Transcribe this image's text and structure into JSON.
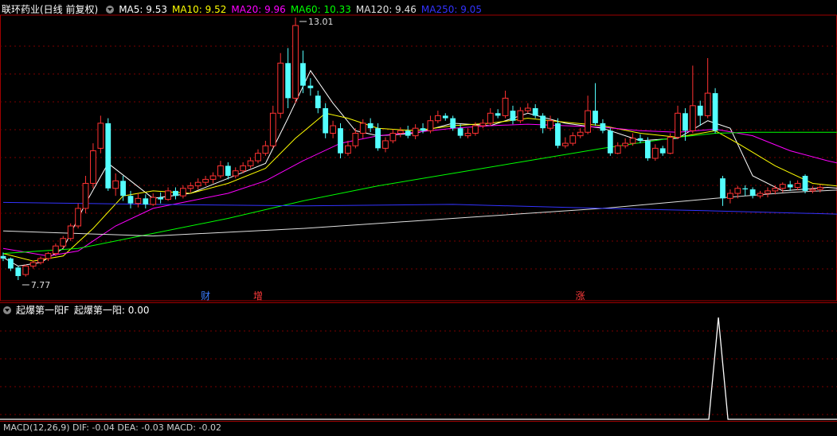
{
  "stock_title": "联环药业(日线 前复权)",
  "ma_legend": [
    {
      "label": "MA5: 9.53",
      "color": "#ffffff"
    },
    {
      "label": "MA10: 9.52",
      "color": "#ffff00"
    },
    {
      "label": "MA20: 9.96",
      "color": "#ff00ff"
    },
    {
      "label": "MA60: 10.33",
      "color": "#00ff00"
    },
    {
      "label": "MA120: 9.46",
      "color": "#e0e0e0"
    },
    {
      "label": "MA250: 9.05",
      "color": "#3333ff"
    }
  ],
  "high_label": "13.01",
  "low_label": "7.77",
  "event_markers": [
    "财",
    "增",
    "涨"
  ],
  "indicator_title": "起爆第一阳F",
  "indicator_value_label": "起爆第一阳: 0.00",
  "bottom_legend": "MACD(12,26,9)  DIF: -0.04  DEA: -0.03  MACD: -0.02",
  "colors": {
    "up": "#ff3232",
    "down": "#54ffff",
    "grid": "#7a0000",
    "border": "#a00000"
  },
  "chart_data": {
    "type": "candlestick",
    "y_high": 13.01,
    "y_low": 7.77,
    "candles": [
      [
        8.25,
        8.2,
        8.32,
        8.15
      ],
      [
        8.2,
        8.0,
        8.22,
        7.95
      ],
      [
        8.02,
        7.85,
        8.05,
        7.77
      ],
      [
        7.88,
        8.05,
        8.08,
        7.84
      ],
      [
        8.05,
        8.12,
        8.16,
        8.0
      ],
      [
        8.12,
        8.2,
        8.24,
        8.08
      ],
      [
        8.2,
        8.3,
        8.33,
        8.15
      ],
      [
        8.3,
        8.45,
        8.5,
        8.25
      ],
      [
        8.45,
        8.6,
        8.65,
        8.4
      ],
      [
        8.6,
        8.85,
        8.9,
        8.55
      ],
      [
        8.85,
        9.2,
        9.3,
        8.8
      ],
      [
        9.2,
        9.7,
        9.85,
        9.1
      ],
      [
        9.7,
        10.35,
        10.5,
        9.6
      ],
      [
        10.4,
        10.9,
        11.05,
        10.3
      ],
      [
        10.9,
        9.6,
        11.0,
        9.55
      ],
      [
        9.6,
        9.75,
        9.9,
        9.45
      ],
      [
        9.75,
        9.45,
        9.85,
        9.35
      ],
      [
        9.45,
        9.3,
        9.55,
        9.2
      ],
      [
        9.3,
        9.4,
        9.5,
        9.22
      ],
      [
        9.4,
        9.28,
        9.48,
        9.2
      ],
      [
        9.28,
        9.42,
        9.5,
        9.25
      ],
      [
        9.42,
        9.38,
        9.52,
        9.3
      ],
      [
        9.38,
        9.55,
        9.62,
        9.35
      ],
      [
        9.55,
        9.45,
        9.62,
        9.38
      ],
      [
        9.45,
        9.6,
        9.66,
        9.4
      ],
      [
        9.6,
        9.65,
        9.72,
        9.52
      ],
      [
        9.65,
        9.72,
        9.8,
        9.58
      ],
      [
        9.72,
        9.78,
        9.85,
        9.66
      ],
      [
        9.78,
        9.85,
        9.92,
        9.7
      ],
      [
        9.85,
        10.05,
        10.15,
        9.8
      ],
      [
        10.05,
        9.85,
        10.12,
        9.78
      ],
      [
        9.85,
        9.95,
        10.02,
        9.8
      ],
      [
        9.95,
        10.05,
        10.12,
        9.9
      ],
      [
        10.05,
        10.15,
        10.22,
        10.0
      ],
      [
        10.15,
        10.3,
        10.38,
        10.1
      ],
      [
        10.3,
        10.45,
        10.55,
        10.25
      ],
      [
        10.45,
        11.1,
        11.25,
        10.4
      ],
      [
        11.1,
        12.1,
        12.3,
        11.0
      ],
      [
        12.1,
        11.4,
        12.4,
        11.2
      ],
      [
        11.4,
        12.85,
        13.01,
        11.3
      ],
      [
        12.1,
        11.65,
        12.35,
        11.5
      ],
      [
        11.65,
        11.6,
        11.8,
        11.45
      ],
      [
        11.45,
        11.2,
        11.55,
        11.1
      ],
      [
        11.2,
        10.7,
        11.3,
        10.6
      ],
      [
        10.7,
        10.85,
        10.95,
        10.6
      ],
      [
        10.8,
        10.3,
        10.9,
        10.2
      ],
      [
        10.3,
        10.45,
        10.55,
        10.25
      ],
      [
        10.45,
        10.7,
        10.8,
        10.4
      ],
      [
        10.7,
        10.9,
        10.98,
        10.6
      ],
      [
        10.9,
        10.8,
        11.0,
        10.72
      ],
      [
        10.8,
        10.4,
        10.9,
        10.35
      ],
      [
        10.4,
        10.55,
        10.62,
        10.32
      ],
      [
        10.55,
        10.7,
        10.78,
        10.5
      ],
      [
        10.7,
        10.75,
        10.82,
        10.62
      ],
      [
        10.75,
        10.65,
        10.85,
        10.6
      ],
      [
        10.65,
        10.8,
        10.88,
        10.58
      ],
      [
        10.8,
        10.75,
        10.9,
        10.7
      ],
      [
        10.75,
        10.95,
        11.05,
        10.7
      ],
      [
        10.95,
        11.05,
        11.15,
        10.9
      ],
      [
        11.05,
        11.0,
        11.1,
        10.95
      ],
      [
        11.0,
        10.8,
        11.05,
        10.75
      ],
      [
        10.8,
        10.65,
        10.88,
        10.6
      ],
      [
        10.65,
        10.7,
        10.8,
        10.6
      ],
      [
        10.7,
        10.85,
        10.92,
        10.65
      ],
      [
        10.85,
        10.9,
        10.98,
        10.8
      ],
      [
        10.9,
        11.1,
        11.2,
        10.85
      ],
      [
        11.1,
        11.05,
        11.18,
        11.0
      ],
      [
        11.05,
        11.4,
        11.55,
        11.0
      ],
      [
        11.15,
        10.95,
        11.25,
        10.88
      ],
      [
        10.95,
        11.15,
        11.22,
        10.9
      ],
      [
        11.15,
        11.2,
        11.3,
        11.1
      ],
      [
        11.2,
        11.05,
        11.28,
        11.0
      ],
      [
        11.05,
        10.8,
        11.1,
        10.7
      ],
      [
        10.8,
        10.95,
        11.05,
        10.75
      ],
      [
        10.9,
        10.45,
        11.0,
        10.4
      ],
      [
        10.45,
        10.5,
        10.62,
        10.4
      ],
      [
        10.5,
        10.65,
        10.72,
        10.45
      ],
      [
        10.65,
        10.72,
        10.8,
        10.6
      ],
      [
        10.72,
        11.15,
        11.45,
        10.68
      ],
      [
        11.15,
        10.9,
        11.7,
        10.85
      ],
      [
        10.9,
        10.75,
        10.98,
        10.7
      ],
      [
        10.75,
        10.3,
        10.8,
        10.25
      ],
      [
        10.3,
        10.45,
        10.52,
        10.28
      ],
      [
        10.45,
        10.5,
        10.6,
        10.4
      ],
      [
        10.5,
        10.6,
        10.7,
        10.45
      ],
      [
        10.6,
        10.55,
        10.68,
        10.5
      ],
      [
        10.55,
        10.2,
        10.62,
        10.15
      ],
      [
        10.2,
        10.4,
        10.48,
        10.15
      ],
      [
        10.4,
        10.3,
        10.45,
        10.25
      ],
      [
        10.3,
        10.62,
        10.7,
        10.28
      ],
      [
        10.62,
        11.1,
        11.25,
        10.58
      ],
      [
        11.1,
        10.75,
        11.2,
        10.55
      ],
      [
        10.75,
        11.25,
        12.05,
        10.7
      ],
      [
        11.25,
        11.05,
        11.35,
        10.85
      ],
      [
        11.05,
        11.5,
        12.2,
        11.0
      ],
      [
        11.5,
        10.75,
        11.6,
        10.7
      ],
      [
        9.8,
        9.4,
        9.85,
        9.25
      ],
      [
        9.4,
        9.5,
        9.58,
        9.3
      ],
      [
        9.5,
        9.6,
        9.65,
        9.4
      ],
      [
        9.6,
        9.58,
        9.66,
        9.45
      ],
      [
        9.58,
        9.45,
        9.62,
        9.4
      ],
      [
        9.45,
        9.5,
        9.55,
        9.4
      ],
      [
        9.5,
        9.55,
        9.62,
        9.42
      ],
      [
        9.55,
        9.6,
        9.66,
        9.48
      ],
      [
        9.6,
        9.68,
        9.72,
        9.52
      ],
      [
        9.68,
        9.62,
        9.75,
        9.55
      ],
      [
        9.62,
        9.7,
        9.76,
        9.56
      ],
      [
        9.85,
        9.55,
        9.88,
        9.5
      ],
      [
        9.55,
        9.58,
        9.64,
        9.5
      ],
      [
        9.58,
        9.62,
        9.68,
        9.52
      ]
    ],
    "ma_lines": {
      "MA5": [
        [
          0,
          8.22
        ],
        [
          2,
          8.05
        ],
        [
          5,
          8.12
        ],
        [
          8,
          8.4
        ],
        [
          11,
          9.3
        ],
        [
          14,
          10.1
        ],
        [
          17,
          9.75
        ],
        [
          20,
          9.4
        ],
        [
          25,
          9.5
        ],
        [
          30,
          9.8
        ],
        [
          35,
          10.1
        ],
        [
          38,
          11.0
        ],
        [
          41,
          11.95
        ],
        [
          44,
          11.3
        ],
        [
          47,
          10.75
        ],
        [
          50,
          10.65
        ],
        [
          55,
          10.7
        ],
        [
          60,
          10.9
        ],
        [
          65,
          10.85
        ],
        [
          70,
          11.1
        ],
        [
          75,
          10.9
        ],
        [
          80,
          10.8
        ],
        [
          85,
          10.55
        ],
        [
          90,
          10.6
        ],
        [
          94,
          10.95
        ],
        [
          97,
          10.8
        ],
        [
          100,
          9.85
        ],
        [
          104,
          9.55
        ],
        [
          110,
          9.62
        ],
        [
          113,
          9.58
        ]
      ],
      "MA10": [
        [
          0,
          8.3
        ],
        [
          4,
          8.15
        ],
        [
          8,
          8.25
        ],
        [
          12,
          8.8
        ],
        [
          16,
          9.45
        ],
        [
          20,
          9.55
        ],
        [
          25,
          9.5
        ],
        [
          30,
          9.7
        ],
        [
          35,
          10.0
        ],
        [
          39,
          10.6
        ],
        [
          43,
          11.1
        ],
        [
          46,
          11.0
        ],
        [
          50,
          10.8
        ],
        [
          55,
          10.75
        ],
        [
          60,
          10.85
        ],
        [
          65,
          10.9
        ],
        [
          70,
          11.0
        ],
        [
          75,
          10.92
        ],
        [
          80,
          10.85
        ],
        [
          85,
          10.7
        ],
        [
          90,
          10.62
        ],
        [
          95,
          10.75
        ],
        [
          98,
          10.5
        ],
        [
          103,
          10.05
        ],
        [
          108,
          9.7
        ],
        [
          113,
          9.62
        ]
      ],
      "MA20": [
        [
          0,
          8.4
        ],
        [
          6,
          8.25
        ],
        [
          10,
          8.35
        ],
        [
          15,
          8.85
        ],
        [
          20,
          9.2
        ],
        [
          25,
          9.35
        ],
        [
          30,
          9.5
        ],
        [
          35,
          9.75
        ],
        [
          40,
          10.15
        ],
        [
          45,
          10.5
        ],
        [
          50,
          10.65
        ],
        [
          55,
          10.72
        ],
        [
          60,
          10.8
        ],
        [
          65,
          10.85
        ],
        [
          70,
          10.88
        ],
        [
          75,
          10.85
        ],
        [
          80,
          10.82
        ],
        [
          85,
          10.75
        ],
        [
          90,
          10.72
        ],
        [
          95,
          10.78
        ],
        [
          100,
          10.65
        ],
        [
          105,
          10.35
        ],
        [
          110,
          10.15
        ],
        [
          113,
          10.05
        ]
      ],
      "MA60": [
        [
          0,
          8.3
        ],
        [
          10,
          8.4
        ],
        [
          15,
          8.55
        ],
        [
          20,
          8.7
        ],
        [
          30,
          9.0
        ],
        [
          40,
          9.35
        ],
        [
          50,
          9.65
        ],
        [
          60,
          9.9
        ],
        [
          70,
          10.15
        ],
        [
          80,
          10.4
        ],
        [
          90,
          10.62
        ],
        [
          95,
          10.7
        ],
        [
          100,
          10.72
        ],
        [
          113,
          10.72
        ]
      ],
      "MA120": [
        [
          0,
          8.75
        ],
        [
          20,
          8.65
        ],
        [
          40,
          8.8
        ],
        [
          60,
          9.0
        ],
        [
          80,
          9.2
        ],
        [
          95,
          9.4
        ],
        [
          105,
          9.52
        ],
        [
          113,
          9.58
        ]
      ],
      "MA250": [
        [
          0,
          9.32
        ],
        [
          20,
          9.28
        ],
        [
          40,
          9.25
        ],
        [
          60,
          9.28
        ],
        [
          80,
          9.2
        ],
        [
          95,
          9.15
        ],
        [
          113,
          9.08
        ]
      ]
    },
    "indicator": {
      "ylim": [
        0,
        1
      ],
      "spike_index": 95,
      "spike_value": 1
    }
  }
}
